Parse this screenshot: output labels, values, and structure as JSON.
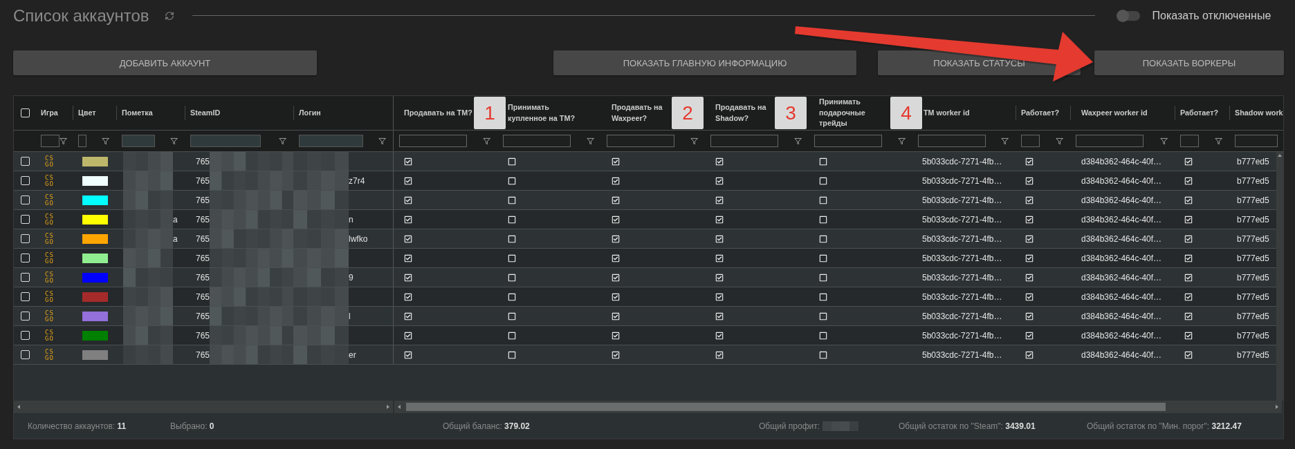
{
  "title": "Список аккаунтов",
  "show_disabled": {
    "label": "Показать отключенные",
    "on": false
  },
  "buttons": [
    "ДОБАВИТЬ АККАУНТ",
    "ПОКАЗАТЬ ГЛАВНУЮ ИНФОРМАЦИЮ",
    "ПОКАЗАТЬ СТАТУСЫ",
    "ПОКАЗАТЬ ВОРКЕРЫ"
  ],
  "select_all": {
    "checked": false
  },
  "columns": [
    "Игра",
    "Цвет",
    "Пометка",
    "SteamID",
    "Логин",
    "Продавать на TM?",
    "Принимать купленное на TM?",
    "Продавать на Waxpeer?",
    "Продавать на Shadow?",
    "Принимать подарочные трейды",
    "TM worker id",
    "Работает?",
    "Waxpeer worker id",
    "Работает?",
    "Shadow work"
  ],
  "rows": [
    {
      "selected": false,
      "game": [
        "CS",
        "GO"
      ],
      "color": "#bdb76b",
      "steamid": "765",
      "sell_tm": true,
      "accept_tm": false,
      "sell_waxpeer": true,
      "sell_shadow": true,
      "accept_gifts": false,
      "tm_worker": "5b033cdc-7271-4fb…",
      "tm_working": true,
      "waxpeer_worker": "d384b362-464c-40f…",
      "waxpeer_working": true,
      "shadow_worker": "b777ed5"
    },
    {
      "selected": false,
      "game": [
        "CS",
        "GO"
      ],
      "color": "#f0ffff",
      "steamid": "765",
      "login": "z7r4",
      "sell_tm": true,
      "accept_tm": false,
      "sell_waxpeer": true,
      "sell_shadow": true,
      "accept_gifts": false,
      "tm_worker": "5b033cdc-7271-4fb…",
      "tm_working": true,
      "waxpeer_worker": "d384b362-464c-40f…",
      "waxpeer_working": true,
      "shadow_worker": "b777ed5"
    },
    {
      "selected": false,
      "game": [
        "CS",
        "GO"
      ],
      "color": "#00ffff",
      "steamid": "765",
      "sell_tm": true,
      "accept_tm": false,
      "sell_waxpeer": true,
      "sell_shadow": true,
      "accept_gifts": false,
      "tm_worker": "5b033cdc-7271-4fb…",
      "tm_working": true,
      "waxpeer_worker": "d384b362-464c-40f…",
      "waxpeer_working": true,
      "shadow_worker": "b777ed5"
    },
    {
      "selected": false,
      "game": [
        "CS",
        "GO"
      ],
      "color": "#ffff00",
      "note": "a",
      "steamid": "765",
      "login": "n",
      "sell_tm": true,
      "accept_tm": false,
      "sell_waxpeer": true,
      "sell_shadow": true,
      "accept_gifts": false,
      "tm_worker": "5b033cdc-7271-4fb…",
      "tm_working": true,
      "waxpeer_worker": "d384b362-464c-40f…",
      "waxpeer_working": true,
      "shadow_worker": "b777ed5"
    },
    {
      "selected": false,
      "game": [
        "CS",
        "GO"
      ],
      "color": "#ffa500",
      "note": "a",
      "steamid": "765",
      "login": "lwfko",
      "sell_tm": true,
      "accept_tm": false,
      "sell_waxpeer": true,
      "sell_shadow": true,
      "accept_gifts": false,
      "tm_worker": "5b033cdc-7271-4fb…",
      "tm_working": true,
      "waxpeer_worker": "d384b362-464c-40f…",
      "waxpeer_working": true,
      "shadow_worker": "b777ed5"
    },
    {
      "selected": false,
      "game": [
        "CS",
        "GO"
      ],
      "color": "#90ee90",
      "steamid": "765",
      "sell_tm": true,
      "accept_tm": false,
      "sell_waxpeer": true,
      "sell_shadow": true,
      "accept_gifts": false,
      "tm_worker": "5b033cdc-7271-4fb…",
      "tm_working": true,
      "waxpeer_worker": "d384b362-464c-40f…",
      "waxpeer_working": true,
      "shadow_worker": "b777ed5"
    },
    {
      "selected": false,
      "game": [
        "CS",
        "GO"
      ],
      "color": "#0000ff",
      "steamid": "765",
      "login": "9",
      "sell_tm": true,
      "accept_tm": false,
      "sell_waxpeer": true,
      "sell_shadow": true,
      "accept_gifts": false,
      "tm_worker": "5b033cdc-7271-4fb…",
      "tm_working": true,
      "waxpeer_worker": "d384b362-464c-40f…",
      "waxpeer_working": true,
      "shadow_worker": "b777ed5"
    },
    {
      "selected": false,
      "game": [
        "CS",
        "GO"
      ],
      "color": "#a52a2a",
      "steamid": "765",
      "sell_tm": true,
      "accept_tm": false,
      "sell_waxpeer": true,
      "sell_shadow": true,
      "accept_gifts": false,
      "tm_worker": "5b033cdc-7271-4fb…",
      "tm_working": true,
      "waxpeer_worker": "d384b362-464c-40f…",
      "waxpeer_working": true,
      "shadow_worker": "b777ed5"
    },
    {
      "selected": false,
      "game": [
        "CS",
        "GO"
      ],
      "color": "#9370db",
      "steamid": "765",
      "login": "l",
      "sell_tm": true,
      "accept_tm": false,
      "sell_waxpeer": true,
      "sell_shadow": true,
      "accept_gifts": false,
      "tm_worker": "5b033cdc-7271-4fb…",
      "tm_working": true,
      "waxpeer_worker": "d384b362-464c-40f…",
      "waxpeer_working": true,
      "shadow_worker": "b777ed5"
    },
    {
      "selected": false,
      "game": [
        "CS",
        "GO"
      ],
      "color": "#008000",
      "steamid": "765",
      "sell_tm": true,
      "accept_tm": false,
      "sell_waxpeer": true,
      "sell_shadow": true,
      "accept_gifts": false,
      "tm_worker": "5b033cdc-7271-4fb…",
      "tm_working": true,
      "waxpeer_worker": "d384b362-464c-40f…",
      "waxpeer_working": true,
      "shadow_worker": "b777ed5"
    },
    {
      "selected": false,
      "game": [
        "CS",
        "GO"
      ],
      "color": "#808080",
      "steamid": "765",
      "login": "er",
      "sell_tm": true,
      "accept_tm": false,
      "sell_waxpeer": true,
      "sell_shadow": true,
      "accept_gifts": false,
      "tm_worker": "5b033cdc-7271-4fb…",
      "tm_working": true,
      "waxpeer_worker": "d384b362-464c-40f…",
      "waxpeer_working": true,
      "shadow_worker": "b777ed5"
    }
  ],
  "footer": [
    {
      "text": "Количество аккаунтов: **11**"
    },
    {
      "text": "Выбрано: **0**"
    },
    {
      "text": "Общий баланс: **379.02**"
    },
    {
      "text": "Общий профит:",
      "redacted": true
    },
    {
      "text": "Общий остаток по \"Steam\": **3439.01**"
    },
    {
      "text": "Общий остаток по \"Мин. порог\": **3212.47**"
    }
  ],
  "annotations": [
    {
      "number": "1"
    },
    {
      "number": "2"
    },
    {
      "number": "3"
    },
    {
      "number": "4"
    }
  ]
}
